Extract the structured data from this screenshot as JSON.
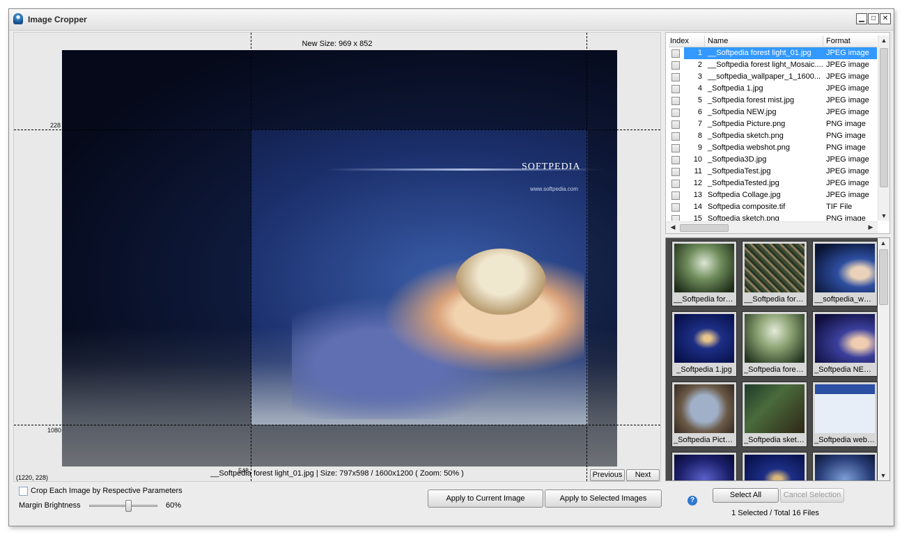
{
  "window": {
    "title": "Image Cropper",
    "controls": [
      "▁",
      "□",
      "✕"
    ]
  },
  "preview": {
    "new_size": "New Size: 969 x 852",
    "left_label": "228",
    "bottom_label": "1080",
    "mark_label": "548",
    "coords": "(1220, 228)",
    "status": "__Softpedia forest light_01.jpg  |  Size: 797x598 / 1600x1200 ( Zoom: 50% )",
    "image_brand": "SOFTPEDIA",
    "image_url": "www.softpedia.com",
    "previous_label": "Previous",
    "next_label": "Next"
  },
  "file_list": {
    "columns": {
      "index": "Index",
      "name": "Name",
      "format": "Format"
    },
    "rows": [
      {
        "index": "1",
        "name": "__Softpedia forest light_01.jpg",
        "format": "JPEG image",
        "selected": true
      },
      {
        "index": "2",
        "name": "__Softpedia forest light_Mosaic....",
        "format": "JPEG image"
      },
      {
        "index": "3",
        "name": "__softpedia_wallpaper_1_1600...",
        "format": "JPEG image"
      },
      {
        "index": "4",
        "name": "_Softpedia 1.jpg",
        "format": "JPEG image"
      },
      {
        "index": "5",
        "name": "_Softpedia forest mist.jpg",
        "format": "JPEG image"
      },
      {
        "index": "6",
        "name": "_Softpedia NEW.jpg",
        "format": "JPEG image"
      },
      {
        "index": "7",
        "name": "_Softpedia Picture.png",
        "format": "PNG image"
      },
      {
        "index": "8",
        "name": "_Softpedia sketch.png",
        "format": "PNG image"
      },
      {
        "index": "9",
        "name": "_Softpedia webshot.png",
        "format": "PNG image"
      },
      {
        "index": "10",
        "name": "_Softpedia3D.jpg",
        "format": "JPEG image"
      },
      {
        "index": "11",
        "name": "_SoftpediaTest.jpg",
        "format": "JPEG image"
      },
      {
        "index": "12",
        "name": "_SoftpediaTested.jpg",
        "format": "JPEG image"
      },
      {
        "index": "13",
        "name": "Softpedia Collage.jpg",
        "format": "JPEG image"
      },
      {
        "index": "14",
        "name": "Softpedia composite.tif",
        "format": "TIF File"
      },
      {
        "index": "15",
        "name": "Softpedia sketch.png",
        "format": "PNG image"
      }
    ]
  },
  "thumbnails": [
    {
      "caption": "__Softpedia fore...",
      "bg": "radial-gradient(ellipse at 50% 40%, #dbe6d4 0%, #6f8c5b 40%, #1d2b18 90%)"
    },
    {
      "caption": "__Softpedia fore...",
      "bg": "repeating-linear-gradient(45deg, #3d4a32 0 4px, #8a7d5c 4px 7px, #263324 7px 10px)"
    },
    {
      "caption": "__softpedia_wall...",
      "bg": "radial-gradient(ellipse at 75% 60%, #e9d2b9 0 14%, #2d4ea0 35%, #0a1434 85%)"
    },
    {
      "caption": "_Softpedia 1.jpg",
      "bg": "radial-gradient(ellipse at 55% 50%, #e7c58b 0 8%, #1d2f86 30%, #07104a 90%)"
    },
    {
      "caption": "_Softpedia forest...",
      "bg": "radial-gradient(ellipse at 50% 35%, #e3ead8 0%, #8aa172 40%, #243520 90%)"
    },
    {
      "caption": "_Softpedia NEW...",
      "bg": "radial-gradient(ellipse at 75% 60%, #f0cdb0 0 12%, #3b3f9c 35%, #100f3e 85%)"
    },
    {
      "caption": "_Softpedia Pictur...",
      "bg": "radial-gradient(circle at 50% 50%, #9fb0c8 0 35%, #6b5a48 60%, #3b2e24 95%)"
    },
    {
      "caption": "_Softpedia sketc...",
      "bg": "linear-gradient(135deg, #1f3a2a 0%, #4a6b3c 40%, #2f2716 100%)"
    },
    {
      "caption": "_Softpedia webs...",
      "bg": "linear-gradient(#2b4fa3 0 20%, #e8eef8 20% 100%)"
    },
    {
      "caption": "",
      "bg": "radial-gradient(ellipse at 50% 50%, #5a61c9 0%, #1b1f6a 60%, #07092e 100%)"
    },
    {
      "caption": "",
      "bg": "radial-gradient(ellipse at 55% 50%, #d9b77a 0 8%, #1d2f86 30%, #07104a 90%)"
    },
    {
      "caption": "",
      "bg": "radial-gradient(ellipse at 50% 50%, #7d9ed6 0%, #2a3f7a 60%, #0c1530 100%)"
    }
  ],
  "options": {
    "crop_each_label": "Crop Each Image by Respective Parameters",
    "margin_brightness_label": "Margin Brightness",
    "margin_brightness_value": "60%",
    "margin_brightness_level": 0.6
  },
  "actions": {
    "apply_current": "Apply to Current Image",
    "apply_selected": "Apply to Selected Images",
    "select_all": "Select All",
    "cancel_selection": "Cancel Selection"
  },
  "summary": "1 Selected / Total 16 Files",
  "colors": {
    "selection": "#3399ff",
    "help_icon": "#2f78d0"
  }
}
